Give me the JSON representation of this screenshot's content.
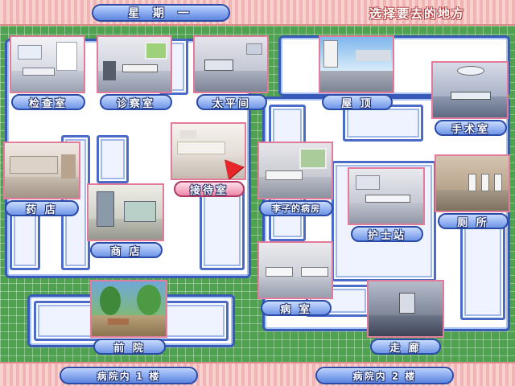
{
  "header": {
    "day_label": "星 期 一",
    "instruction": "选择要去的地方"
  },
  "floors": {
    "floor1": "病院内 1 楼",
    "floor2": "病院内 2 楼"
  },
  "locations": {
    "exam_room": "检查室",
    "consult_room": "诊察室",
    "morgue": "太平间",
    "rooftop": "屋 顶",
    "surgery": "手术室",
    "reception": "接待室",
    "pharmacy": "药 店",
    "shop": "商 店",
    "lizi_ward": "李子的病房",
    "nurse_station": "护士站",
    "toilet": "厕 所",
    "ward": "病 室",
    "front_yard": "前 院",
    "corridor": "走 廊"
  },
  "colors": {
    "accent": "#3a5ab8",
    "thumb_border": "#e37c9a",
    "cursor": "#e8262a"
  },
  "icons": {
    "cursor": "pointer-arrow-icon"
  }
}
